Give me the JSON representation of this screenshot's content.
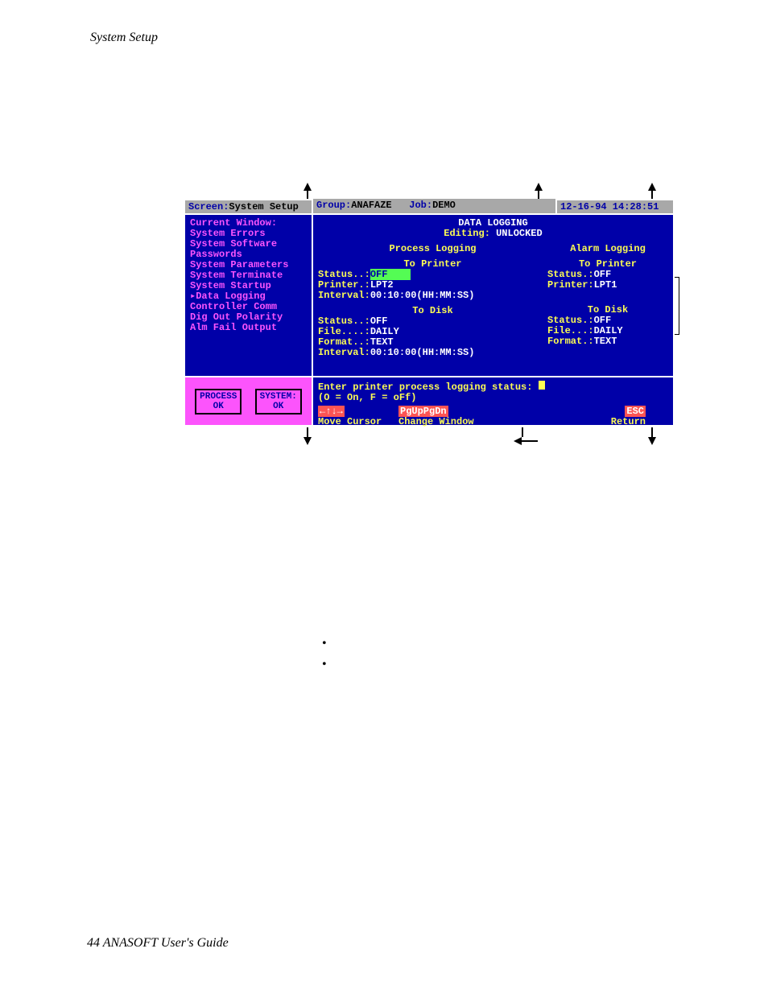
{
  "page": {
    "header_left": "System Setup",
    "footer": "44  ANASOFT User's Guide"
  },
  "top": {
    "screen_label": "Screen:",
    "screen_value": "System Setup",
    "group_label": "Group:",
    "group_value": "ANAFAZE",
    "job_label": "Job:",
    "job_value": "DEMO",
    "datetime": "12-16-94 14:28:51"
  },
  "sidebar": {
    "heading": "Current Window:",
    "items": [
      "System Errors",
      "System Software",
      "Passwords",
      "System Parameters",
      "System Terminate",
      "System Startup",
      "Data Logging",
      "Controller Comm",
      "Dig Out Polarity",
      "Alm Fail Output"
    ]
  },
  "main": {
    "title": "DATA LOGGING",
    "editing_label": "Editing:",
    "editing_value": " UNLOCKED",
    "process_heading": "Process Logging",
    "alarm_heading": "Alarm Logging",
    "printer_heading": "To Printer",
    "disk_heading": "To Disk",
    "process_printer": {
      "status_k": "Status..:",
      "status_v": "OFF",
      "printer_k": "Printer.:",
      "printer_v": "LPT2",
      "interval_k": "Interval:",
      "interval_v": "00:10:00(HH:MM:SS)"
    },
    "process_disk": {
      "status_k": "Status..:",
      "status_v": "OFF",
      "file_k": "File....:",
      "file_v": "DAILY",
      "format_k": "Format..:",
      "format_v": "TEXT",
      "interval_k": "Interval:",
      "interval_v": "00:10:00(HH:MM:SS)"
    },
    "alarm_printer": {
      "status_k": "Status.:",
      "status_v": "OFF",
      "printer_k": "Printer:",
      "printer_v": "LPT1"
    },
    "alarm_disk": {
      "status_k": "Status.:",
      "status_v": "OFF",
      "file_k": "File...:",
      "file_v": "DAILY",
      "format_k": "Format.:",
      "format_v": "TEXT"
    }
  },
  "status": {
    "process_label": "PROCESS",
    "process_value": "OK",
    "system_label": "SYSTEM:",
    "system_value": "OK"
  },
  "help": {
    "prompt": "Enter printer process logging status:",
    "hint": "(O = On, F = oFf)",
    "arrows": "←↑↓→",
    "arrows_label": "Move Cursor",
    "pg": "PgUpPgDn",
    "pg_label": "Change Window",
    "esc": "ESC",
    "esc_label": "Return"
  }
}
